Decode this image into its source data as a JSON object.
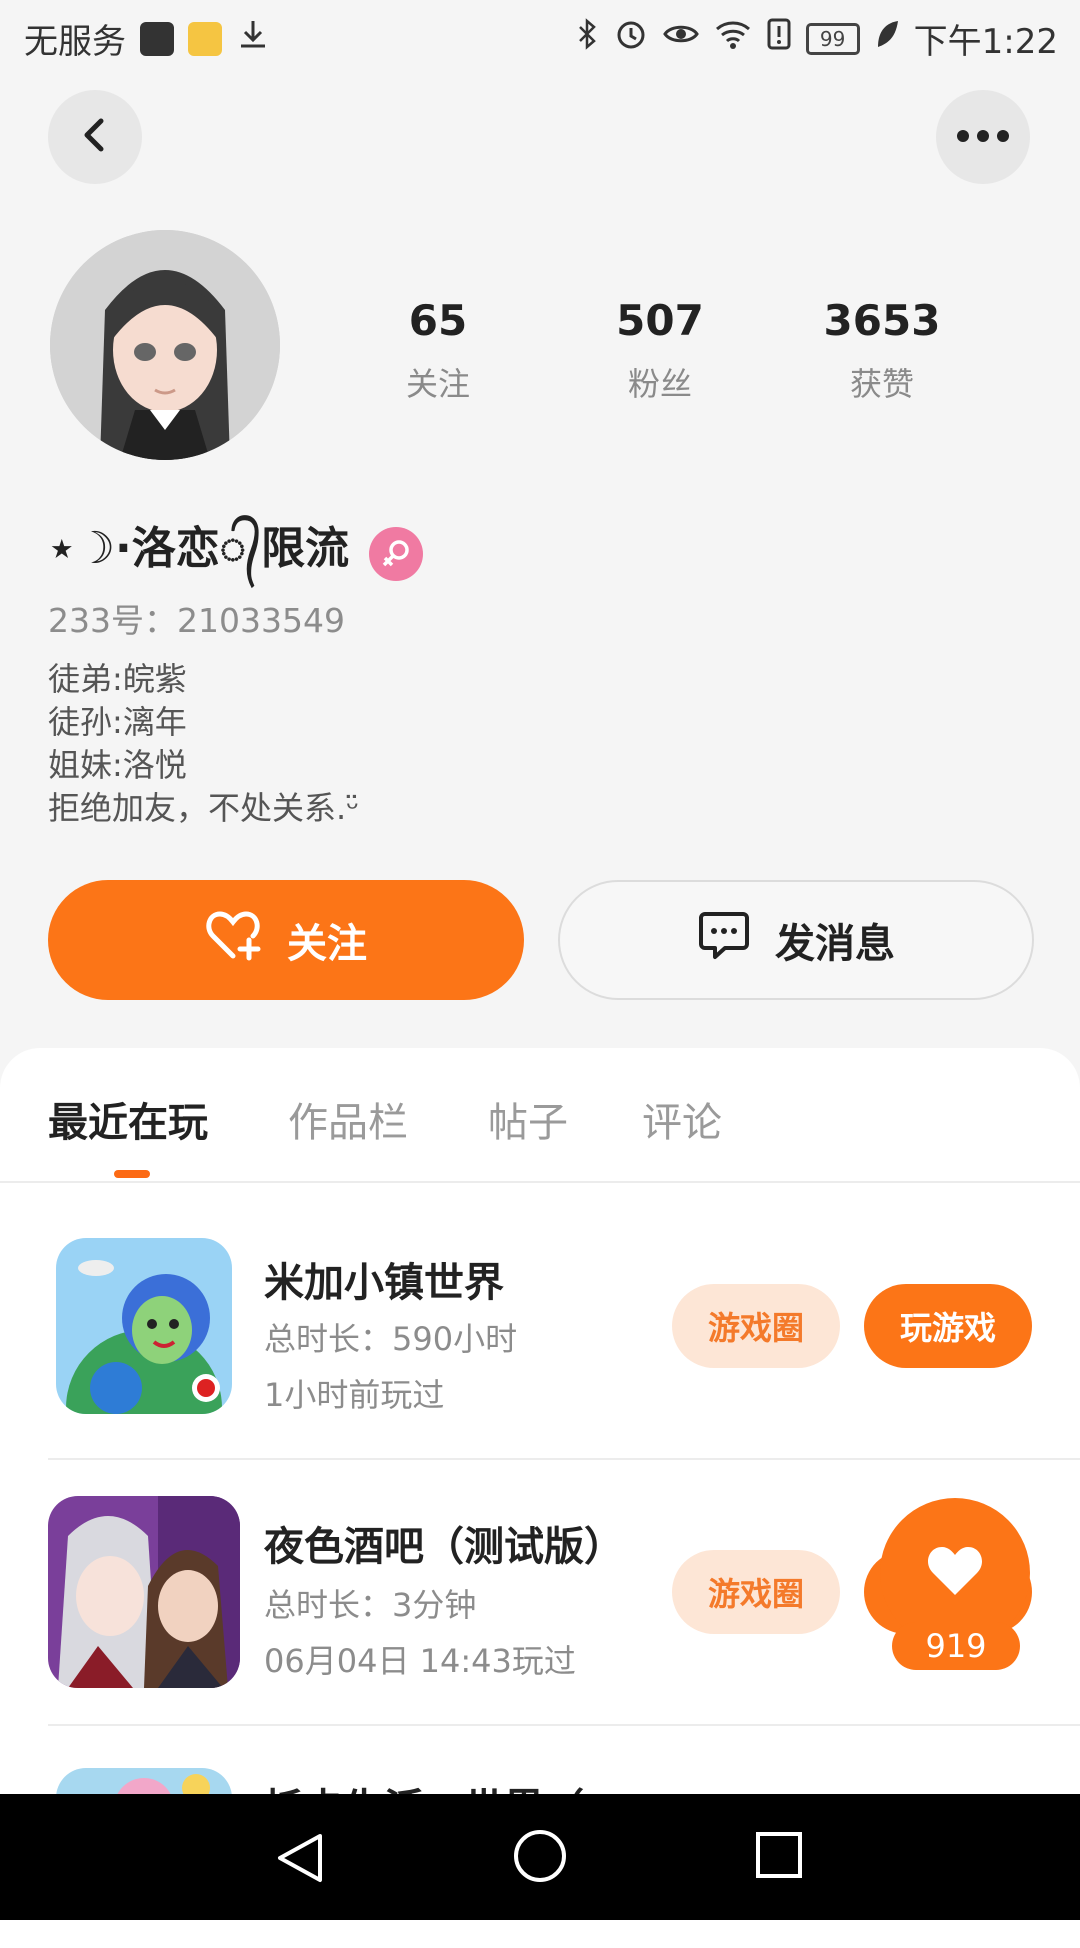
{
  "status_bar": {
    "carrier": "无服务",
    "time": "下午1:22",
    "battery": "99"
  },
  "profile": {
    "stats": [
      {
        "value": "65",
        "label": "关注"
      },
      {
        "value": "507",
        "label": "粉丝"
      },
      {
        "value": "3653",
        "label": "获赞"
      }
    ],
    "username": "⋆☽·洛恋᭄限流",
    "id_line": "233号：21033549",
    "bio": [
      "徒弟:皖紫",
      "徒孙:漓年",
      "姐妹:洛悦",
      "拒绝加友，不处关系.ᵕ̈"
    ]
  },
  "actions": {
    "follow_label": "关注",
    "message_label": "发消息"
  },
  "tabs": [
    "最近在玩",
    "作品栏",
    "帖子",
    "评论"
  ],
  "games": [
    {
      "title": "米加小镇世界",
      "duration": "总时长：590小时",
      "last_played": "1小时前玩过",
      "circle_label": "游戏圈",
      "play_label": "玩游戏"
    },
    {
      "title": "夜色酒吧（测试版）",
      "duration": "总时长：3分钟",
      "last_played": "06月04日 14:43玩过",
      "circle_label": "游戏圈"
    },
    {
      "title": "托卡生活：世界（"
    }
  ],
  "like_count": "919",
  "colors": {
    "accent": "#fc7517",
    "pill_bg": "#fde6d6",
    "gender_badge": "#f07aa2"
  }
}
